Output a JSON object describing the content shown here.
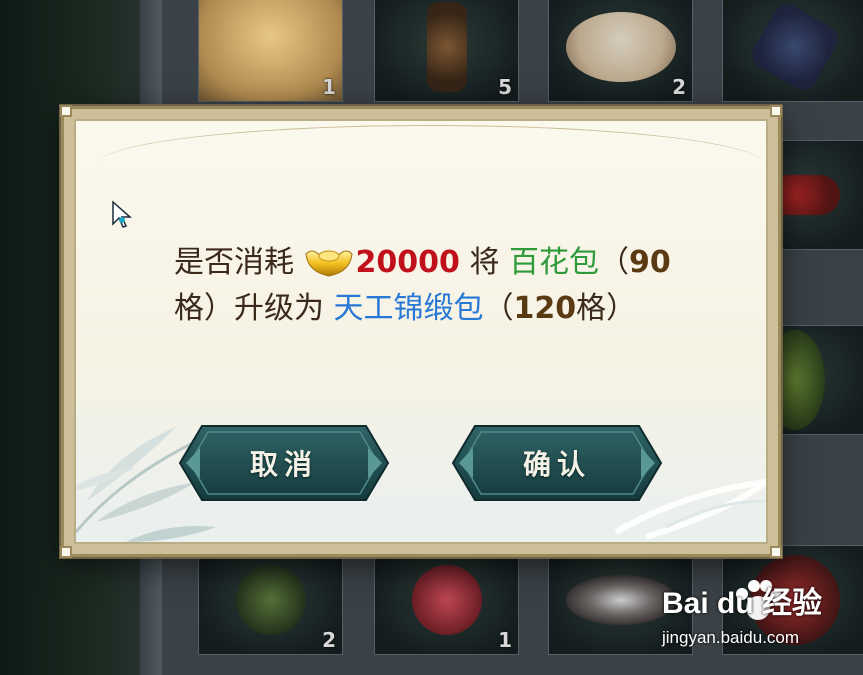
{
  "inventory": {
    "top_row_counts": [
      "1",
      "5",
      "2",
      ""
    ],
    "bottom_row_counts": [
      "2",
      "1",
      "",
      ""
    ]
  },
  "dialog": {
    "line1_prefix": "是否消耗",
    "cost": "20000",
    "line1_mid": " 将 ",
    "bag_current": "百花包",
    "paren_open": "（",
    "bag_current_slots": "90",
    "slots_unit_close": "格）升级为 ",
    "bag_target": "天工锦缎包",
    "paren_open2": "（",
    "bag_target_slots": "120",
    "slots_unit_close2": "格）",
    "currency_icon": "gold-ingot-icon",
    "cancel_label": "取消",
    "confirm_label": "确认"
  },
  "watermark": {
    "brand": "Bai du 经验",
    "url": "jingyan.baidu.com"
  },
  "colors": {
    "cost": "#c0101c",
    "bag_current": "#2e9a3a",
    "bag_target": "#2878d6",
    "button_fill": "#1e4a4c"
  }
}
